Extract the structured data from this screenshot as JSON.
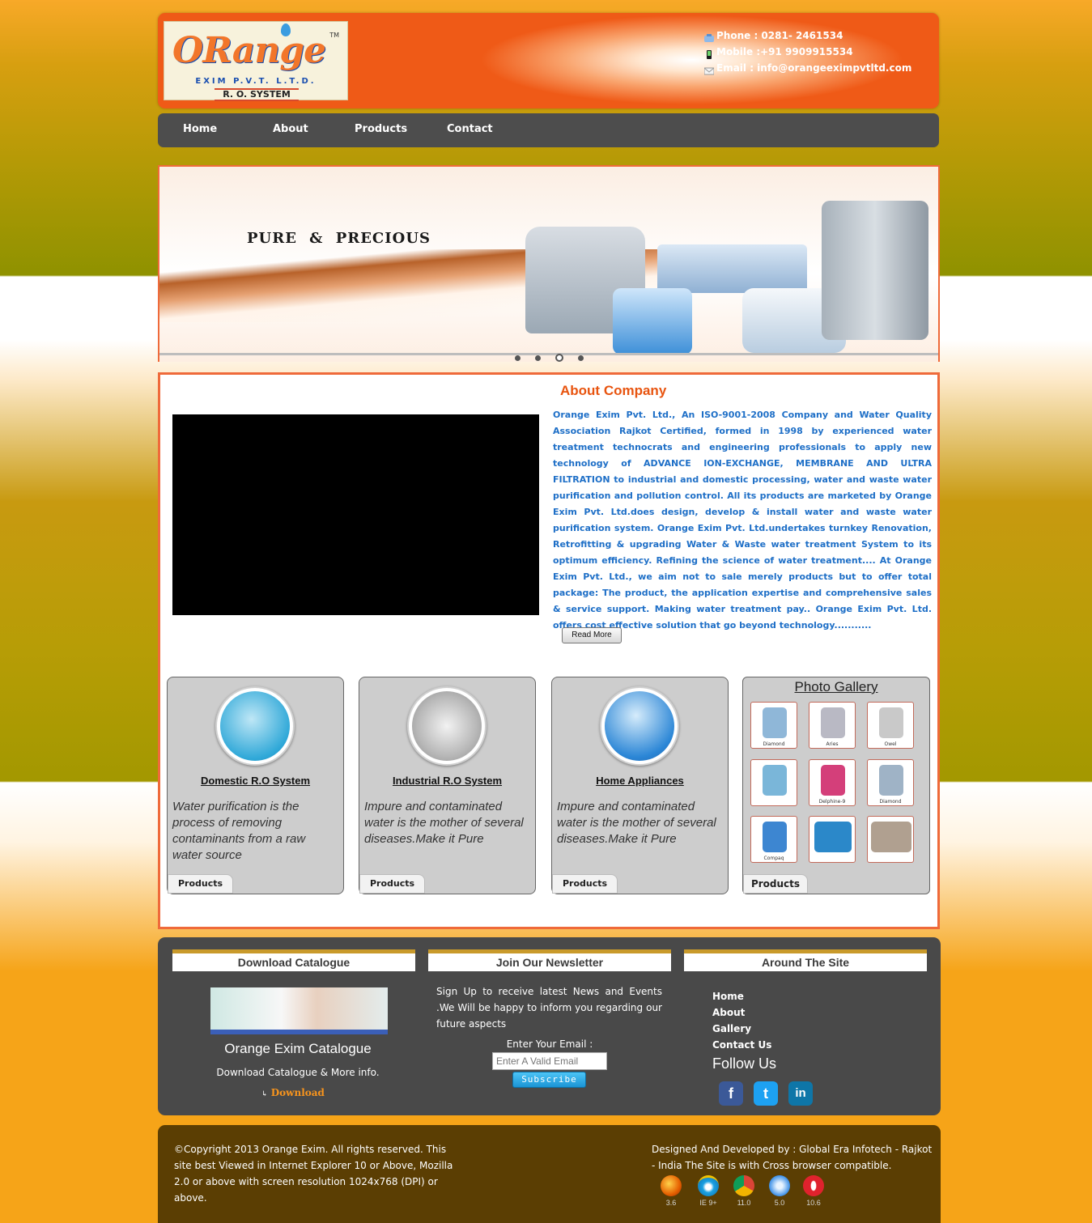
{
  "header": {
    "logo_text": "ORange",
    "logo_sub1": "EXIM P.V.T. L.T.D.",
    "logo_sub2": "R. O. SYSTEM",
    "logo_tm": "TM",
    "phone": "Phone : 0281- 2461534",
    "mobile": "Mobile :+91 9909915534",
    "email": "Email  : info@orangeeximpvtltd.com"
  },
  "nav": {
    "items": [
      "Home",
      "About",
      "Products",
      "Contact"
    ]
  },
  "banner": {
    "slogan": "PURE  &  PRECIOUS",
    "slide_count": 4,
    "active_slide": 3
  },
  "about": {
    "title": "About Company",
    "text": "Orange Exim Pvt. Ltd., An ISO-9001-2008 Company and Water Quality Association Rajkot Certified, formed in 1998 by experienced water treatment technocrats and engineering professionals to apply new technology of ADVANCE ION-EXCHANGE, MEMBRANE AND ULTRA FILTRATION to industrial and domestic processing, water and waste water purification and pollution control. All its products are marketed by Orange Exim Pvt. Ltd.does design, develop & install water and waste water purification system. Orange Exim Pvt. Ltd.undertakes turnkey Renovation, Retrofitting & upgrading Water & Waste water treatment System to its optimum efficiency. Refining the science of water treatment.... At Orange Exim Pvt. Ltd., we aim not to sale merely products but to offer total package: The product, the application expertise and comprehensive sales & service support. Making water treatment pay.. Orange Exim Pvt. Ltd. offers cost effective solution that go beyond technology...........",
    "read_more": "Read More"
  },
  "cards": [
    {
      "title": "Domestic R.O System",
      "desc": "Water purification is the process of removing contaminants from a raw water source",
      "button": "Products",
      "color": "#2fa8d8"
    },
    {
      "title": "Industrial R.O System",
      "desc": "Impure and contaminated water is the mother of several diseases.Make it Pure",
      "button": "Products",
      "color": "#8a8a8a"
    },
    {
      "title": "Home Appliances",
      "desc": "Impure and contaminated water is the mother of several diseases.Make it Pure",
      "button": "Products",
      "color": "#2b86d6"
    }
  ],
  "gallery": {
    "title": "Photo Gallery",
    "button": "Products",
    "thumbs": [
      {
        "label": "Diamond",
        "color": "#8fb7d8"
      },
      {
        "label": "Aries",
        "color": "#b9b9c4"
      },
      {
        "label": "Owel",
        "color": "#c9c9c9"
      },
      {
        "label": "",
        "color": "#7ab6d9"
      },
      {
        "label": "Delphine-9",
        "color": "#d43f7a"
      },
      {
        "label": "Diamond",
        "color": "#9fb3c6"
      },
      {
        "label": "Compaq",
        "color": "#3d86d1"
      },
      {
        "label": "",
        "color": "#2b88c9"
      },
      {
        "label": "",
        "color": "#b0a090"
      }
    ]
  },
  "footer": {
    "catalogue_head": "Download Catalogue",
    "catalogue_title": "Orange Exim Catalogue",
    "catalogue_sub": "Download Catalogue & More info.",
    "catalogue_download": "Download",
    "newsletter_head": "Join Our Newsletter",
    "newsletter_text": "Sign Up to receive latest News and Events .We Will be happy to inform you regarding our future aspects",
    "newsletter_label": "Enter Your Email :",
    "newsletter_placeholder": "Enter A Valid Email",
    "newsletter_button": "Subscribe",
    "around_head": "Around The Site",
    "around_links": [
      "Home",
      "About",
      "Gallery",
      "Contact Us"
    ],
    "follow": "Follow Us",
    "social": [
      {
        "name": "facebook",
        "glyph": "f",
        "color": "#3b5998"
      },
      {
        "name": "twitter",
        "glyph": "t",
        "color": "#1da1f2"
      },
      {
        "name": "linkedin",
        "glyph": "in",
        "color": "#0e76a8"
      }
    ]
  },
  "bottom": {
    "copyright": "©Copyright 2013 Orange Exim. All rights reserved. This site best Viewed in Internet Explorer 10 or Above, Mozilla 2.0 or above with screen resolution 1024x768 (DPI) or above.",
    "credit": "Designed And Developed by : Global Era Infotech - Rajkot - India The Site is with Cross browser compatible.",
    "browsers": [
      {
        "name": "firefox",
        "version": "3.6",
        "color": "#e66000"
      },
      {
        "name": "ie",
        "version": "IE 9+",
        "color": "#1ba1e2"
      },
      {
        "name": "chrome",
        "version": "11.0",
        "color": "#3cba54"
      },
      {
        "name": "safari",
        "version": "5.0",
        "color": "#3a8ee6"
      },
      {
        "name": "opera",
        "version": "10.6",
        "color": "#e0222d"
      }
    ]
  }
}
